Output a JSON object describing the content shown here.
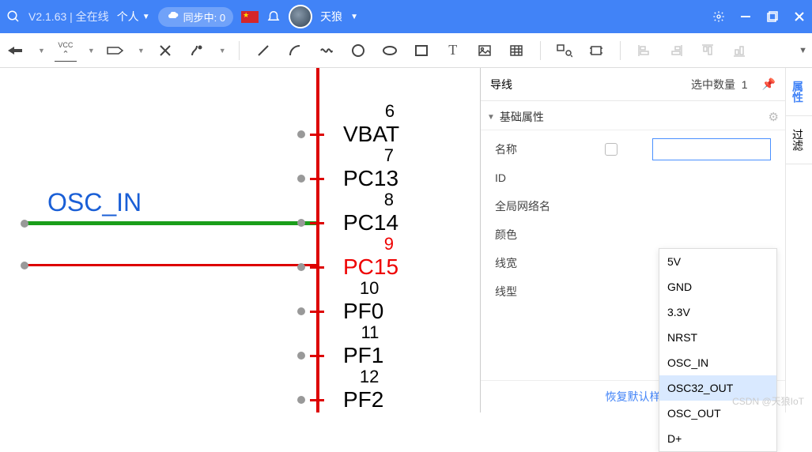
{
  "titlebar": {
    "version": "V2.1.63 | 全在线",
    "personal": "个人",
    "sync": "同步中: 0",
    "username": "天狼"
  },
  "panel": {
    "title": "导线",
    "count_label": "选中数量",
    "count": "1",
    "section": "基础属性",
    "rows": {
      "name": "名称",
      "id": "ID",
      "netname": "全局网络名",
      "color": "颜色",
      "width": "线宽",
      "style": "线型"
    },
    "reset": "恢复默认样",
    "tabs": {
      "props": "属性",
      "filter": "过滤"
    }
  },
  "dropdown": {
    "opts": [
      "5V",
      "GND",
      "3.3V",
      "NRST",
      "OSC_IN",
      "OSC32_OUT",
      "OSC_OUT",
      "D+"
    ]
  },
  "canvas": {
    "netlabel": "OSC_IN",
    "pins": [
      {
        "n": "6",
        "label": "VBAT"
      },
      {
        "n": "7",
        "label": "PC13"
      },
      {
        "n": "8",
        "label": "PC14"
      },
      {
        "n": "9",
        "label": "PC15"
      },
      {
        "n": "10",
        "label": "PF0"
      },
      {
        "n": "11",
        "label": "PF1"
      },
      {
        "n": "12",
        "label": "PF2"
      }
    ]
  },
  "watermark": "CSDN @天狼IoT"
}
